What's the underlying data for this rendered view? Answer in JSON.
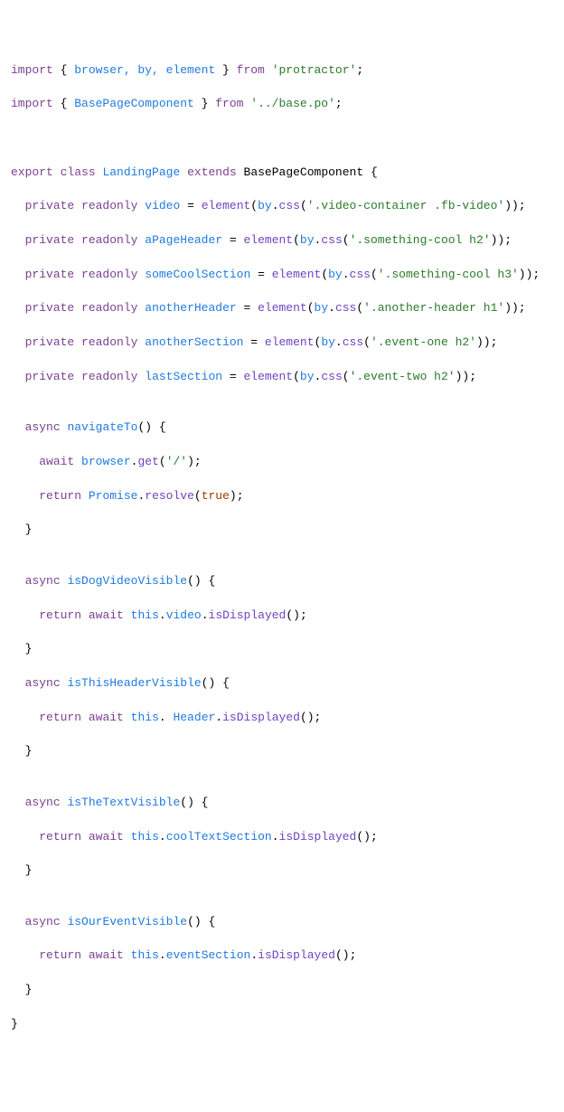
{
  "lines": {
    "l1": {
      "import": "import",
      "lbrace": " { ",
      "names": "browser, by, element",
      "rbrace": " } ",
      "from": "from",
      "path": "'protractor'",
      "semi": ";"
    },
    "l2": {
      "import": "import",
      "lbrace": " { ",
      "names": "BasePageComponent",
      "rbrace": " } ",
      "from": "from",
      "path": "'../base.po'",
      "semi": ";"
    },
    "l3": "",
    "l4": "",
    "l5": {
      "export": "export",
      "class": "class",
      "name": "LandingPage",
      "extends": "extends",
      "base": "BasePageComponent",
      "brace": " {"
    },
    "l6": {
      "indent": "  ",
      "private": "private",
      "readonly": "readonly",
      "prop": "video",
      "eq": " = ",
      "element": "element",
      "lp": "(",
      "by": "by",
      "dot": ".",
      "css": "css",
      "lp2": "(",
      "sel": "'.video-container .fb-video'",
      "rp": "));"
    },
    "l7": {
      "indent": "  ",
      "private": "private",
      "readonly": "readonly",
      "prop": "aPageHeader",
      "eq": " = ",
      "element": "element",
      "lp": "(",
      "by": "by",
      "dot": ".",
      "css": "css",
      "lp2": "(",
      "sel": "'.something-cool h2'",
      "rp": "));"
    },
    "l8": {
      "indent": "  ",
      "private": "private",
      "readonly": "readonly",
      "prop": "someCoolSection",
      "eq": " = ",
      "element": "element",
      "lp": "(",
      "by": "by",
      "dot": ".",
      "css": "css",
      "lp2": "(",
      "sel": "'.something-cool h3'",
      "rp": "));"
    },
    "l9": {
      "indent": "  ",
      "private": "private",
      "readonly": "readonly",
      "prop": "anotherHeader",
      "eq": " = ",
      "element": "element",
      "lp": "(",
      "by": "by",
      "dot": ".",
      "css": "css",
      "lp2": "(",
      "sel": "'.another-header h1'",
      "rp": "));"
    },
    "l10": {
      "indent": "  ",
      "private": "private",
      "readonly": "readonly",
      "prop": "anotherSection",
      "eq": " = ",
      "element": "element",
      "lp": "(",
      "by": "by",
      "dot": ".",
      "css": "css",
      "lp2": "(",
      "sel": "'.event-one h2'",
      "rp": "));"
    },
    "l11": {
      "indent": "  ",
      "private": "private",
      "readonly": "readonly",
      "prop": "lastSection",
      "eq": " = ",
      "element": "element",
      "lp": "(",
      "by": "by",
      "dot": ".",
      "css": "css",
      "lp2": "(",
      "sel": "'.event-two h2'",
      "rp": "));"
    },
    "l12": "",
    "l13": {
      "indent": "  ",
      "async": "async",
      "name": "navigateTo",
      "sig": "() {"
    },
    "l14": {
      "indent": "    ",
      "await": "await",
      "browser": "browser",
      "dot": ".",
      "get": "get",
      "lp": "(",
      "path": "'/'",
      "rp": ");"
    },
    "l15": {
      "indent": "    ",
      "return": "return",
      "promise": "Promise",
      "dot": ".",
      "resolve": "resolve",
      "lp": "(",
      "true": "true",
      "rp": ");"
    },
    "l16": {
      "indent": "  ",
      "brace": "}"
    },
    "l17": "",
    "l18": {
      "indent": "  ",
      "async": "async",
      "name": "isDogVideoVisible",
      "sig": "() {"
    },
    "l19": {
      "indent": "    ",
      "return": "return",
      "await": "await",
      "this": "this",
      "dot": ".",
      "member": "video",
      "dot2": ".",
      "call": "isDisplayed",
      "paren": "();"
    },
    "l20": {
      "indent": "  ",
      "brace": "}"
    },
    "l21": {
      "indent": "  ",
      "async": "async",
      "name": "isThisHeaderVisible",
      "sig": "() {"
    },
    "l22": {
      "indent": "    ",
      "return": "return",
      "await": "await",
      "this": "this",
      "dot": ". ",
      "member": "Header",
      "dot2": ".",
      "call": "isDisplayed",
      "paren": "();"
    },
    "l23": {
      "indent": "  ",
      "brace": "}"
    },
    "l24": "",
    "l25": {
      "indent": "  ",
      "async": "async",
      "name": "isTheTextVisible",
      "sig": "() {"
    },
    "l26": {
      "indent": "    ",
      "return": "return",
      "await": "await",
      "this": "this",
      "dot": ".",
      "member": "coolTextSection",
      "dot2": ".",
      "call": "isDisplayed",
      "paren": "();"
    },
    "l27": {
      "indent": "  ",
      "brace": "}"
    },
    "l28": "",
    "l29": {
      "indent": "  ",
      "async": "async",
      "name": "isOurEventVisible",
      "sig": "() {"
    },
    "l30": {
      "indent": "    ",
      "return": "return",
      "await": "await",
      "this": "this",
      "dot": ".",
      "member": "eventSection",
      "dot2": ".",
      "call": "isDisplayed",
      "paren": "();"
    },
    "l31": {
      "indent": "  ",
      "brace": "}"
    },
    "l32": {
      "brace": "}"
    }
  }
}
